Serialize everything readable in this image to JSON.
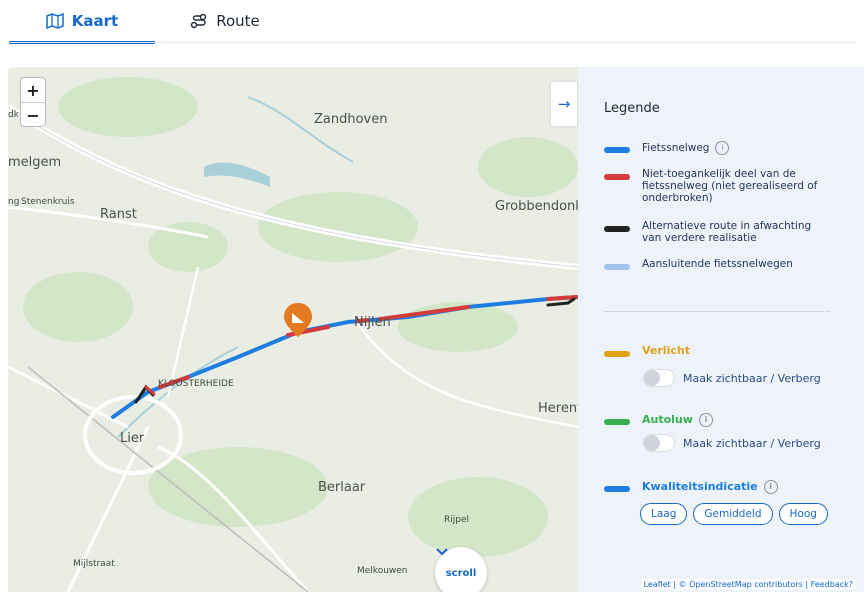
{
  "tabs": [
    {
      "label": "Kaart",
      "icon": "map-icon",
      "active": true
    },
    {
      "label": "Route",
      "icon": "route-icon",
      "active": false
    }
  ],
  "map": {
    "zoom_in": "+",
    "zoom_out": "−",
    "places": [
      {
        "name": "Zandhoven"
      },
      {
        "name": "melgem"
      },
      {
        "name": "Stenenkruis"
      },
      {
        "name": "Ranst"
      },
      {
        "name": "Grobbendonk"
      },
      {
        "name": "Nijlen"
      },
      {
        "name": "KLOOSTERHEIDE"
      },
      {
        "name": "Herenthout"
      },
      {
        "name": "Lier"
      },
      {
        "name": "Berlaar"
      },
      {
        "name": "Rijpel"
      },
      {
        "name": "Mijlstraat"
      },
      {
        "name": "Melkouwen"
      },
      {
        "name": "dk"
      },
      {
        "name": "ng"
      }
    ],
    "scroll_label": "scroll",
    "attribution": "Leaflet | © OpenStreetMap contributors | Feedback?"
  },
  "legend": {
    "title": "Legende",
    "items": [
      {
        "label": "Fietssnelweg",
        "color": "#1e7de0",
        "info": true
      },
      {
        "label": "Niet-toegankelijk deel van de fietssnelweg (niet gerealiseerd of onderbroken)",
        "color": "#d43b3b",
        "info": false
      },
      {
        "label": "Alternatieve route in afwachting van verdere realisatie",
        "color": "#222222",
        "info": false
      },
      {
        "label": "Aansluitende fietssnelwegen",
        "color": "#a2c4ec",
        "info": false
      }
    ],
    "categories": [
      {
        "label": "Verlicht",
        "color": "#e0a21b",
        "toggle": "Maak zichtbaar / Verberg"
      },
      {
        "label": "Autoluw",
        "color": "#34b04f",
        "toggle": "Maak zichtbaar / Verberg",
        "info": true
      },
      {
        "label": "Kwaliteitsindicatie",
        "color": "#1e7de0",
        "info": true
      }
    ],
    "quality": [
      "Laag",
      "Gemiddeld",
      "Hoog"
    ]
  },
  "colors": {
    "accent": "#1769c9"
  }
}
